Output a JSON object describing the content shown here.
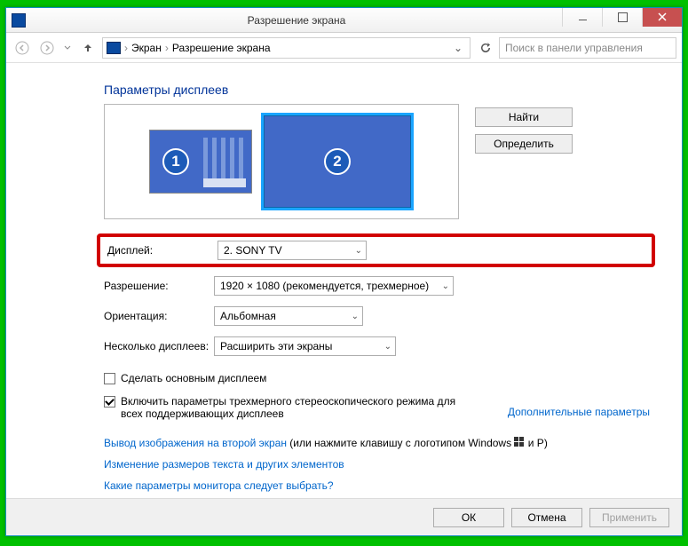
{
  "window": {
    "title": "Разрешение экрана"
  },
  "breadcrumb": {
    "item1": "Экран",
    "item2": "Разрешение экрана"
  },
  "search": {
    "placeholder": "Поиск в панели управления"
  },
  "heading": "Параметры дисплеев",
  "monitors": {
    "n1": "1",
    "n2": "2"
  },
  "side": {
    "find": "Найти",
    "detect": "Определить"
  },
  "form": {
    "display_label": "Дисплей:",
    "display_value": "2. SONY TV",
    "resolution_label": "Разрешение:",
    "resolution_value": "1920 × 1080 (рекомендуется, трехмерное)",
    "orientation_label": "Ориентация:",
    "orientation_value": "Альбомная",
    "multi_label": "Несколько дисплеев:",
    "multi_value": "Расширить эти экраны"
  },
  "checks": {
    "primary": "Сделать основным дисплеем",
    "stereo": "Включить параметры трехмерного стереоскопического режима для всех поддерживающих дисплеев"
  },
  "links": {
    "advanced": "Дополнительные параметры",
    "project_prefix": "Вывод изображения на второй экран",
    "project_suffix": " (или нажмите клавишу с логотипом Windows ",
    "project_end": " и P)",
    "textsize": "Изменение размеров текста и других элементов",
    "which": "Какие параметры монитора следует выбрать?"
  },
  "footer": {
    "ok": "ОК",
    "cancel": "Отмена",
    "apply": "Применить"
  }
}
